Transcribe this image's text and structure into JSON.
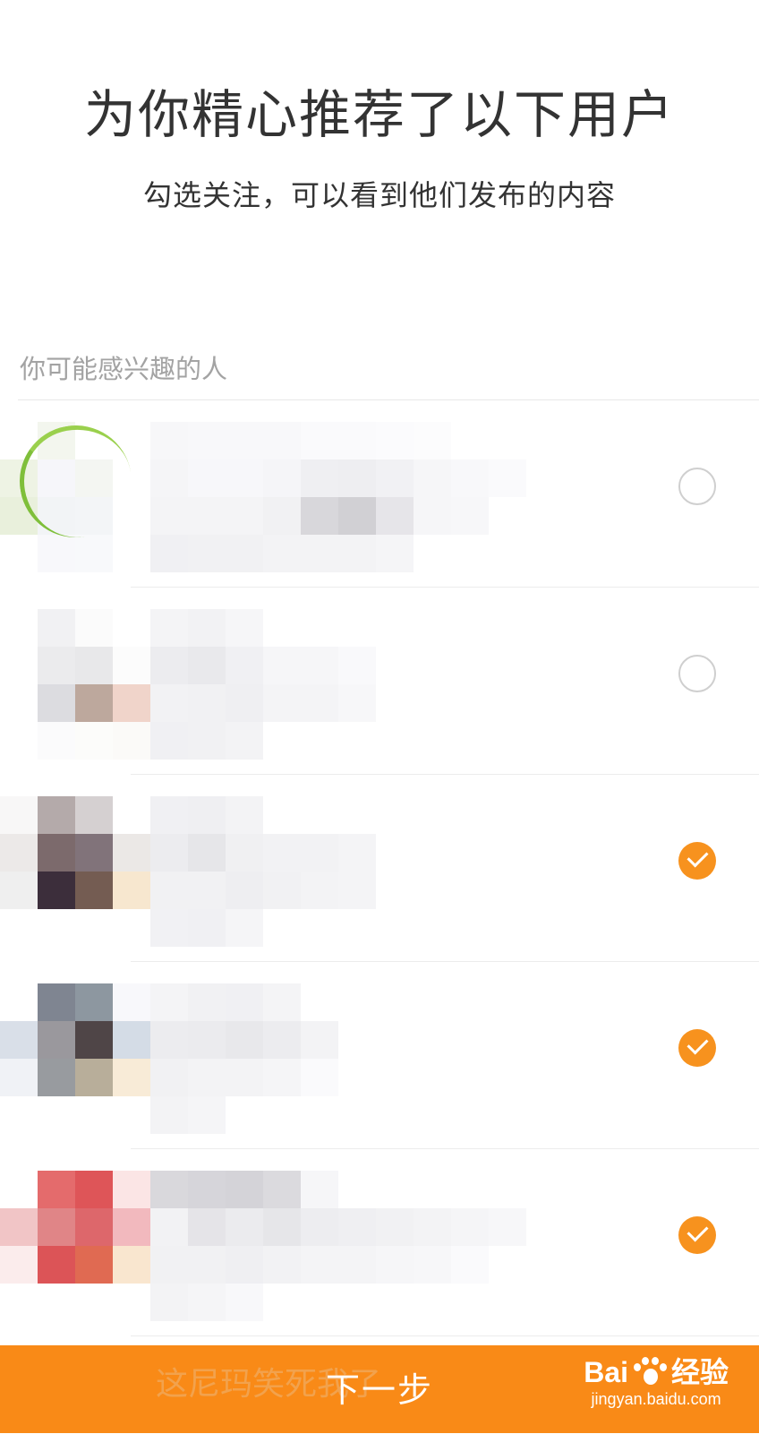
{
  "header": {
    "title": "为你精心推荐了以下用户",
    "subtitle": "勾选关注，可以看到他们发布的内容"
  },
  "section": {
    "label": "你可能感兴趣的人"
  },
  "users": [
    {
      "checked": false,
      "state_icon": "unchecked-circle-icon"
    },
    {
      "checked": false,
      "state_icon": "unchecked-circle-icon"
    },
    {
      "checked": true,
      "state_icon": "checkmark-icon"
    },
    {
      "checked": true,
      "state_icon": "checkmark-icon"
    },
    {
      "checked": true,
      "state_icon": "checkmark-icon"
    }
  ],
  "footer": {
    "next_label": "下一步",
    "background_text": "这尼玛笑死我了"
  },
  "watermark": {
    "brand": "Bai",
    "brand_suffix": "经验",
    "url": "jingyan.baidu.com"
  },
  "colors": {
    "accent": "#f98a17",
    "check_on": "#f7921e",
    "check_off_border": "#cfcfcf"
  }
}
